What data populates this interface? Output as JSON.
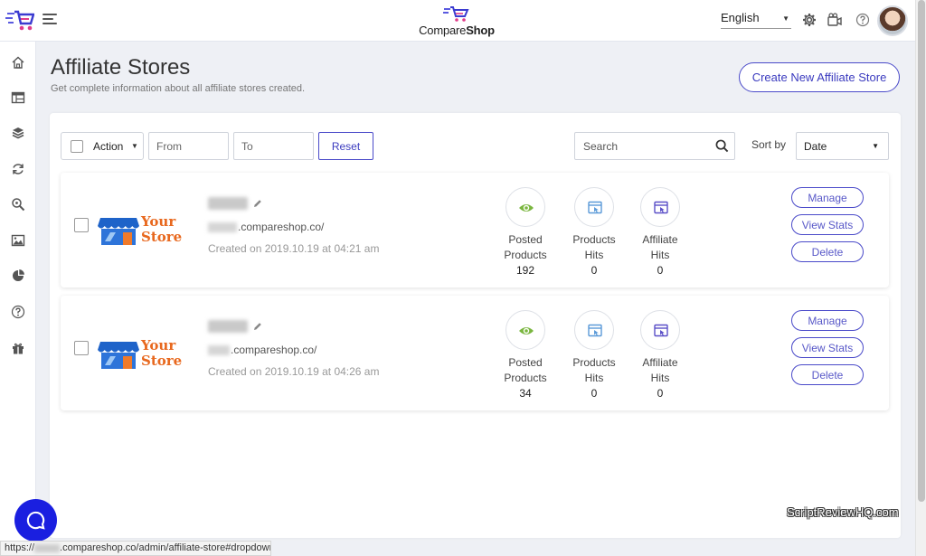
{
  "header": {
    "brand_prefix": "Compare",
    "brand_suffix": "Shop",
    "language": "English",
    "icons": [
      "logo-icon",
      "menu-icon",
      "gear-icon",
      "video-icon",
      "help-icon",
      "avatar"
    ]
  },
  "sidebar": {
    "items": [
      "home-icon",
      "table-icon",
      "box-icon",
      "sync-icon",
      "search-gear-icon",
      "image-icon",
      "pie-icon",
      "help-icon",
      "gift-icon"
    ]
  },
  "page": {
    "title": "Affiliate Stores",
    "subtitle": "Get complete information about all affiliate stores created.",
    "create_label": "Create New Affiliate Store"
  },
  "toolbar": {
    "action_label": "Action",
    "from_placeholder": "From",
    "to_placeholder": "To",
    "reset_label": "Reset",
    "search_placeholder": "Search",
    "sort_label": "Sort by",
    "sort_value": "Date"
  },
  "stores": [
    {
      "logo_line1": "Your",
      "logo_line2": "Store",
      "url_suffix": ".compareshop.co/",
      "created": "Created on 2019.10.19 at 04:21 am",
      "stats": [
        {
          "label1": "Posted",
          "label2": "Products",
          "value": "192"
        },
        {
          "label1": "Products",
          "label2": "Hits",
          "value": "0"
        },
        {
          "label1": "Affiliate",
          "label2": "Hits",
          "value": "0"
        }
      ],
      "actions": {
        "manage": "Manage",
        "view_stats": "View Stats",
        "delete": "Delete"
      }
    },
    {
      "logo_line1": "Your",
      "logo_line2": "Store",
      "url_suffix": ".compareshop.co/",
      "created": "Created on 2019.10.19 at 04:26 am",
      "stats": [
        {
          "label1": "Posted",
          "label2": "Products",
          "value": "34"
        },
        {
          "label1": "Products",
          "label2": "Hits",
          "value": "0"
        },
        {
          "label1": "Affiliate",
          "label2": "Hits",
          "value": "0"
        }
      ],
      "actions": {
        "manage": "Manage",
        "view_stats": "View Stats",
        "delete": "Delete"
      }
    }
  ],
  "watermark": "ScriptReviewHQ.com",
  "statusbar": {
    "prefix": "https://",
    "suffix": ".compareshop.co/admin/affiliate-store#dropdown-help"
  },
  "colors": {
    "accent": "#3b3bbf",
    "store_orange": "#e8681e",
    "awning_blue": "#1e63c9",
    "eye_green": "#7ab63f",
    "chat_blue": "#1a1fe0"
  }
}
